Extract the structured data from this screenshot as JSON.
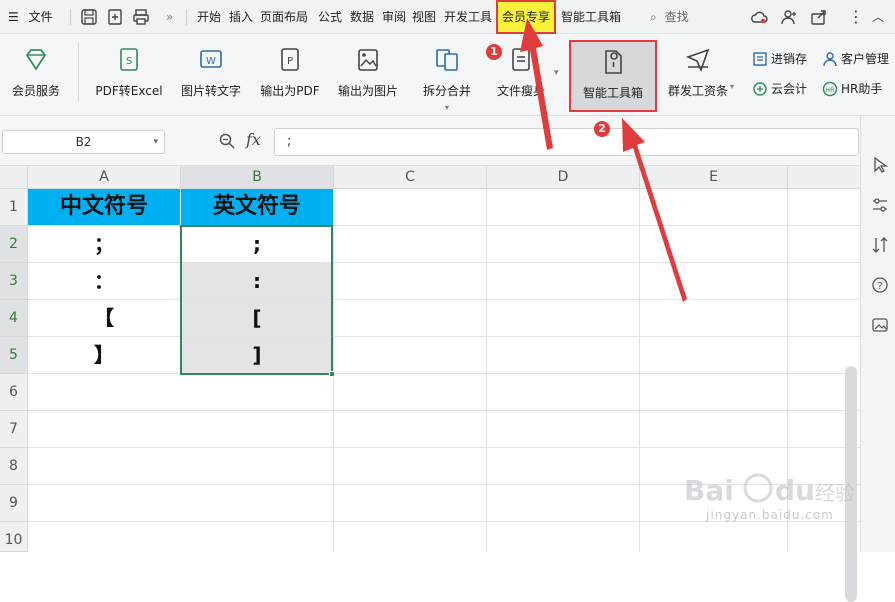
{
  "menubar": {
    "file_label": "文件",
    "tabs": [
      {
        "label": "开始"
      },
      {
        "label": "插入"
      },
      {
        "label": "页面布局"
      },
      {
        "label": "公式"
      },
      {
        "label": "数据"
      },
      {
        "label": "审阅"
      },
      {
        "label": "视图"
      },
      {
        "label": "开发工具"
      },
      {
        "label": "会员专享"
      },
      {
        "label": "智能工具箱"
      }
    ],
    "search_label": "查找",
    "active_tab_color": "#f7f23a"
  },
  "ribbon": {
    "buttons": [
      {
        "label": "会员服务",
        "icon": "diamond-icon"
      },
      {
        "label": "PDF转Excel",
        "icon": "pdf-to-excel-icon"
      },
      {
        "label": "图片转文字",
        "icon": "image-to-text-icon"
      },
      {
        "label": "输出为PDF",
        "icon": "export-pdf-icon"
      },
      {
        "label": "输出为图片",
        "icon": "export-image-icon"
      },
      {
        "label": "拆分合并",
        "icon": "split-merge-icon"
      },
      {
        "label": "文件瘦身",
        "icon": "file-slim-icon"
      },
      {
        "label": "智能工具箱",
        "icon": "toolbox-icon"
      },
      {
        "label": "群发工资条",
        "icon": "payslip-icon"
      }
    ],
    "small_buttons": [
      {
        "label": "进销存",
        "icon": "inventory-icon"
      },
      {
        "label": "客户管理",
        "icon": "customer-icon"
      },
      {
        "label": "云会计",
        "icon": "cloud-accounting-icon"
      },
      {
        "label": "HR助手",
        "icon": "hr-icon"
      }
    ]
  },
  "formula_bar": {
    "cell_ref": "B2",
    "fx_label": "fx",
    "content": ";"
  },
  "sheet": {
    "columns": [
      "A",
      "B",
      "C",
      "D",
      "E"
    ],
    "rows": [
      "1",
      "2",
      "3",
      "4",
      "5",
      "6",
      "7",
      "8",
      "9",
      "10"
    ],
    "header_fill": "#00b0f0",
    "cells": {
      "A1": "中文符号",
      "B1": "英文符号",
      "A2": "；",
      "B2": ";",
      "A3": "：",
      "B3": ":",
      "A4": "【",
      "B4": "[",
      "A5": "】",
      "B5": "]"
    }
  },
  "annotations": {
    "marker_1": "1",
    "marker_2": "2",
    "color": "#e23b3b"
  },
  "watermark": {
    "brand": "Bai du 经验",
    "url": "jingyan.baidu.com"
  }
}
